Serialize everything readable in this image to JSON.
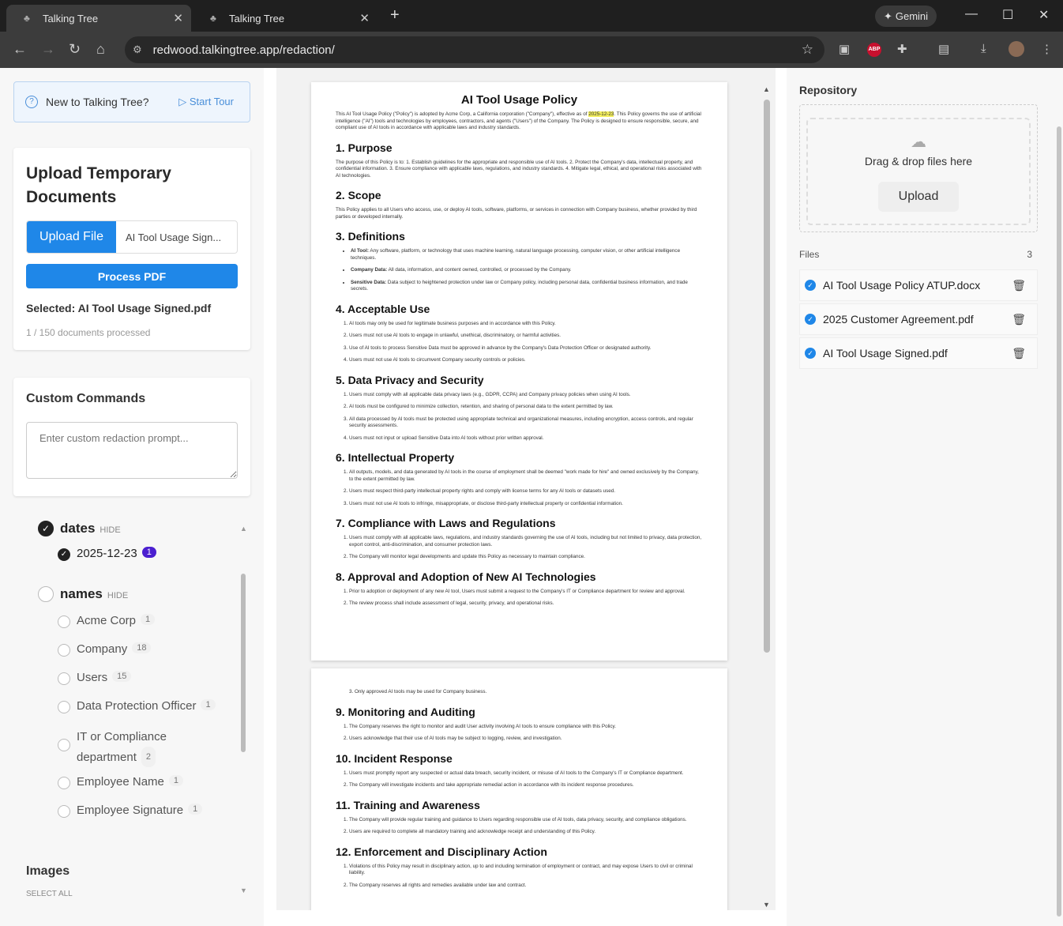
{
  "browser": {
    "tabs": [
      {
        "title": "Talking Tree"
      },
      {
        "title": "Talking Tree"
      }
    ],
    "gemini_label": "Gemini",
    "url": "redwood.talkingtree.app/redaction/"
  },
  "left": {
    "tour": {
      "text": "New to Talking Tree?",
      "button": "Start Tour"
    },
    "upload": {
      "title": "Upload Temporary Documents",
      "upload_button": "Upload File",
      "file_name": "AI Tool Usage Sign...",
      "process_button": "Process PDF",
      "selected": "Selected: AI Tool Usage Signed.pdf",
      "count": "1 / 150 documents processed"
    },
    "custom": {
      "title": "Custom Commands",
      "placeholder": "Enter custom redaction prompt..."
    },
    "entities": {
      "dates": {
        "label": "dates",
        "hide": "HIDE",
        "items": [
          {
            "label": "2025-12-23",
            "count": "1"
          }
        ]
      },
      "names": {
        "label": "names",
        "hide": "HIDE",
        "items": [
          {
            "label": "Acme Corp",
            "count": "1"
          },
          {
            "label": "Company",
            "count": "18"
          },
          {
            "label": "Users",
            "count": "15"
          },
          {
            "label": "Data Protection Officer",
            "count": "1"
          },
          {
            "label": "IT or Compliance department",
            "count": "2"
          },
          {
            "label": "Employee Name",
            "count": "1"
          },
          {
            "label": "Employee Signature",
            "count": "1"
          }
        ]
      }
    },
    "images": {
      "title": "Images",
      "select_all": "SELECT ALL"
    }
  },
  "doc": {
    "title": "AI Tool Usage Policy",
    "intro_a": "This AI Tool Usage Policy (\"Policy\") is adopted by Acme Corp, a California corporation (\"Company\"), effective as of ",
    "intro_date": "2025-12-23",
    "intro_b": ". This Policy governs the use of artificial intelligence (\"AI\") tools and technologies by employees, contractors, and agents (\"Users\") of the Company. The Policy is designed to ensure responsible, secure, and compliant use of AI tools in accordance with applicable laws and industry standards.",
    "s1": {
      "h": "1. Purpose",
      "p": "The purpose of this Policy is to: 1. Establish guidelines for the appropriate and responsible use of AI tools. 2. Protect the Company's data, intellectual property, and confidential information. 3. Ensure compliance with applicable laws, regulations, and industry standards. 4. Mitigate legal, ethical, and operational risks associated with AI technologies."
    },
    "s2": {
      "h": "2. Scope",
      "p": "This Policy applies to all Users who access, use, or deploy AI tools, software, platforms, or services in connection with Company business, whether provided by third parties or developed internally."
    },
    "s3": {
      "h": "3. Definitions",
      "d1t": "AI Tool:",
      "d1": " Any software, platform, or technology that uses machine learning, natural language processing, computer vision, or other artificial intelligence techniques.",
      "d2t": "Company Data:",
      "d2": " All data, information, and content owned, controlled, or processed by the Company.",
      "d3t": "Sensitive Data:",
      "d3": " Data subject to heightened protection under law or Company policy, including personal data, confidential business information, and trade secrets."
    },
    "s4": {
      "h": "4. Acceptable Use",
      "items": [
        "AI tools may only be used for legitimate business purposes and in accordance with this Policy.",
        "Users must not use AI tools to engage in unlawful, unethical, discriminatory, or harmful activities.",
        "Use of AI tools to process Sensitive Data must be approved in advance by the Company's Data Protection Officer or designated authority.",
        "Users must not use AI tools to circumvent Company security controls or policies."
      ]
    },
    "s5": {
      "h": "5. Data Privacy and Security",
      "items": [
        "Users must comply with all applicable data privacy laws (e.g., GDPR, CCPA) and Company privacy policies when using AI tools.",
        "AI tools must be configured to minimize collection, retention, and sharing of personal data to the extent permitted by law.",
        "All data processed by AI tools must be protected using appropriate technical and organizational measures, including encryption, access controls, and regular security assessments.",
        "Users must not input or upload Sensitive Data into AI tools without prior written approval."
      ]
    },
    "s6": {
      "h": "6. Intellectual Property",
      "items": [
        "All outputs, models, and data generated by AI tools in the course of employment shall be deemed \"work made for hire\" and owned exclusively by the Company, to the extent permitted by law.",
        "Users must respect third-party intellectual property rights and comply with license terms for any AI tools or datasets used.",
        "Users must not use AI tools to infringe, misappropriate, or disclose third-party intellectual property or confidential information."
      ]
    },
    "s7": {
      "h": "7. Compliance with Laws and Regulations",
      "items": [
        "Users must comply with all applicable laws, regulations, and industry standards governing the use of AI tools, including but not limited to privacy, data protection, export control, anti-discrimination, and consumer protection laws.",
        "The Company will monitor legal developments and update this Policy as necessary to maintain compliance."
      ]
    },
    "s8": {
      "h": "8. Approval and Adoption of New AI Technologies",
      "items": [
        "Prior to adoption or deployment of any new AI tool, Users must submit a request to the Company's IT or Compliance department for review and approval.",
        "The review process shall include assessment of legal, security, privacy, and operational risks."
      ]
    },
    "p2_top": "3. Only approved AI tools may be used for Company business.",
    "s9": {
      "h": "9. Monitoring and Auditing",
      "items": [
        "The Company reserves the right to monitor and audit User activity involving AI tools to ensure compliance with this Policy.",
        "Users acknowledge that their use of AI tools may be subject to logging, review, and investigation."
      ]
    },
    "s10": {
      "h": "10. Incident Response",
      "items": [
        "Users must promptly report any suspected or actual data breach, security incident, or misuse of AI tools to the Company's IT or Compliance department.",
        "The Company will investigate incidents and take appropriate remedial action in accordance with its incident response procedures."
      ]
    },
    "s11": {
      "h": "11. Training and Awareness",
      "items": [
        "The Company will provide regular training and guidance to Users regarding responsible use of AI tools, data privacy, security, and compliance obligations.",
        "Users are required to complete all mandatory training and acknowledge receipt and understanding of this Policy."
      ]
    },
    "s12": {
      "h": "12. Enforcement and Disciplinary Action",
      "items": [
        "Violations of this Policy may result in disciplinary action, up to and including termination of employment or contract, and may expose Users to civil or criminal liability.",
        "The Company reserves all rights and remedies available under law and contract."
      ]
    }
  },
  "right": {
    "title": "Repository",
    "drop_text": "Drag & drop files here",
    "upload_button": "Upload",
    "files_label": "Files",
    "files_count": "3",
    "files": [
      {
        "name": "AI Tool Usage Policy ATUP.docx"
      },
      {
        "name": "2025 Customer Agreement.pdf"
      },
      {
        "name": "AI Tool Usage Signed.pdf"
      }
    ]
  },
  "colors": {
    "accent": "#1f87e8",
    "badge": "#4b1fd0",
    "highlight": "#f3ee5f"
  }
}
